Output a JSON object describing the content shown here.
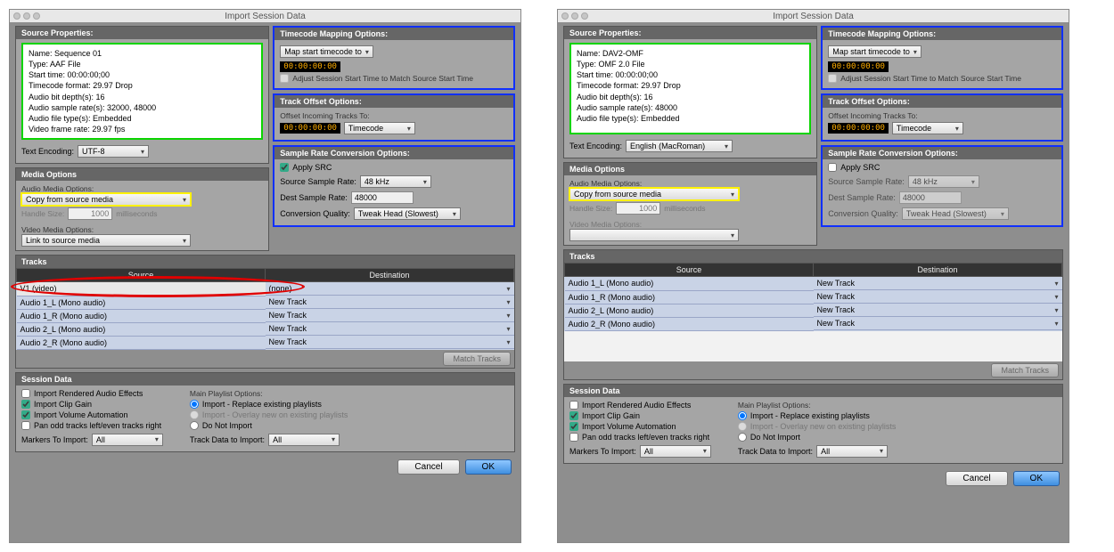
{
  "window_title": "Import Session Data",
  "headers": {
    "source_props": "Source Properties:",
    "tc_mapping": "Timecode Mapping Options:",
    "track_offset": "Track Offset Options:",
    "src_options": "Sample Rate Conversion Options:",
    "media_options": "Media Options",
    "tracks": "Tracks",
    "session_data": "Session Data"
  },
  "labels": {
    "text_encoding": "Text Encoding:",
    "map_start": "Map start timecode to",
    "adjust_start": "Adjust Session Start Time to Match Source Start Time",
    "offset_incoming": "Offset Incoming Tracks To:",
    "apply_src": "Apply SRC",
    "src_sr": "Source Sample Rate:",
    "dest_sr": "Dest Sample Rate:",
    "conv_q": "Conversion Quality:",
    "audio_media": "Audio Media Options:",
    "handle": "Handle Size:",
    "ms": "milliseconds",
    "video_media": "Video Media Options:",
    "th_source": "Source",
    "th_dest": "Destination",
    "match_tracks": "Match Tracks",
    "imp_rendered": "Import Rendered Audio Effects",
    "imp_clipgain": "Import Clip Gain",
    "imp_volauto": "Import Volume Automation",
    "pan_odd": "Pan odd tracks left/even tracks right",
    "markers": "Markers To Import:",
    "main_playlist": "Main Playlist Options:",
    "pl_replace": "Import - Replace existing playlists",
    "pl_overlay": "Import - Overlay new on existing playlists",
    "pl_donot": "Do Not Import",
    "track_data": "Track Data to Import:",
    "cancel": "Cancel",
    "ok": "OK",
    "tc_select": "Timecode",
    "markers_all": "All",
    "trackdata_all": "All",
    "handle_val": "1000"
  },
  "left": {
    "props": [
      "Name: Sequence 01",
      "Type: AAF File",
      "Start time: 00:00:00;00",
      "Timecode format: 29.97 Drop",
      "Audio bit depth(s): 16",
      "Audio sample rate(s): 32000, 48000",
      "Audio file type(s): Embedded",
      "Video frame rate: 29.97 fps"
    ],
    "encoding": "UTF-8",
    "tc_display": "00:00:00:00",
    "offset_tc": "00:00:00:00",
    "apply_src": true,
    "src_sr": "48 kHz",
    "dest_sr": "48000",
    "conv_q": "Tweak Head (Slowest)",
    "audio_media": "Copy from source media",
    "video_media": "Link to source media",
    "tracks": [
      {
        "src": "V1 (video)",
        "dest": "(none)",
        "video": true
      },
      {
        "src": "Audio 1_L (Mono audio)",
        "dest": "New Track"
      },
      {
        "src": "Audio 1_R (Mono audio)",
        "dest": "New Track"
      },
      {
        "src": "Audio 2_L (Mono audio)",
        "dest": "New Track"
      },
      {
        "src": "Audio 2_R (Mono audio)",
        "dest": "New Track"
      }
    ]
  },
  "right": {
    "props": [
      "Name: DAV2-OMF",
      "Type: OMF 2.0 File",
      "Start time: 00:00:00;00",
      "Timecode format: 29.97 Drop",
      "Audio bit depth(s): 16",
      "Audio sample rate(s): 48000",
      "Audio file type(s): Embedded"
    ],
    "encoding": "English (MacRoman)",
    "tc_display": "00:00:00:00",
    "offset_tc": "00:00:00:00",
    "apply_src": false,
    "src_sr": "48 kHz",
    "dest_sr": "48000",
    "conv_q": "Tweak Head (Slowest)",
    "audio_media": "Copy from source media",
    "tracks": [
      {
        "src": "Audio 1_L (Mono audio)",
        "dest": "New Track"
      },
      {
        "src": "Audio 1_R (Mono audio)",
        "dest": "New Track"
      },
      {
        "src": "Audio 2_L (Mono audio)",
        "dest": "New Track"
      },
      {
        "src": "Audio 2_R (Mono audio)",
        "dest": "New Track"
      }
    ]
  }
}
